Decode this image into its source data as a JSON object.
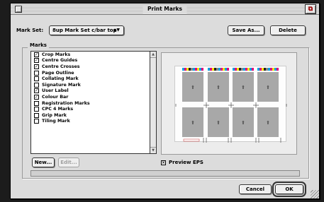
{
  "window": {
    "title": "Print Marks"
  },
  "mark_set": {
    "label": "Mark Set:",
    "selected": "8up Mark Set c/bar top"
  },
  "buttons": {
    "save_as": "Save As...",
    "delete": "Delete",
    "new": "New...",
    "edit": "Edit...",
    "cancel": "Cancel",
    "ok": "OK"
  },
  "marks": {
    "label": "Marks",
    "items": [
      {
        "label": "Crop Marks",
        "checked": true
      },
      {
        "label": "Centre Guides",
        "checked": true
      },
      {
        "label": "Centre Crosses",
        "checked": true
      },
      {
        "label": "Page Outline",
        "checked": false
      },
      {
        "label": "Collating Mark",
        "checked": false
      },
      {
        "label": "Signature Mark",
        "checked": false
      },
      {
        "label": "User Label",
        "checked": true
      },
      {
        "label": "Colour Bar",
        "checked": true
      },
      {
        "label": "Registration Marks",
        "checked": false
      },
      {
        "label": "CPC 4 Marks",
        "checked": false
      },
      {
        "label": "Grip Mark",
        "checked": false
      },
      {
        "label": "Tiling Mark",
        "checked": false
      }
    ]
  },
  "preview_eps": {
    "label": "Preview EPS",
    "checked": true
  },
  "colors": {
    "window_bg": "#dcdcdc",
    "page_tile": "#a8a8a8",
    "screen_bg": "#1c1c1c"
  },
  "icons": {
    "close": "close-box-icon",
    "zoom": "zoom-box-icon",
    "popup": "popup-arrows-icon",
    "page": "page-arrow-icon"
  }
}
